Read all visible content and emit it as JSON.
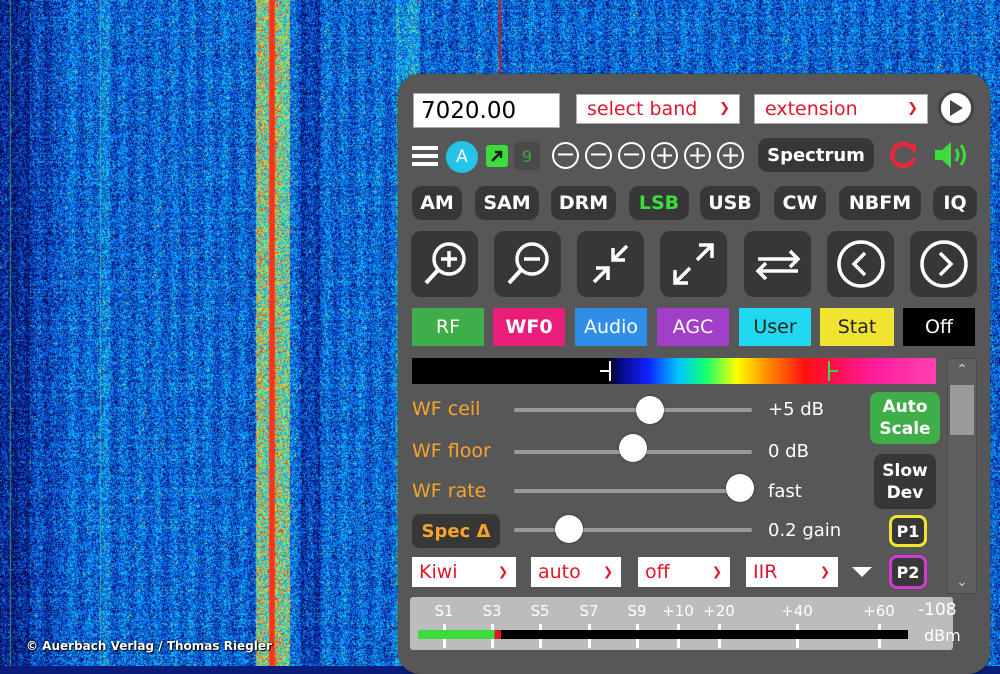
{
  "credit": "© Auerbach Verlag / Thomas Riegler",
  "frequency": {
    "value": "7020.00"
  },
  "band_select": {
    "label": "select band"
  },
  "extension_select": {
    "label": "extension"
  },
  "toolbar": {
    "badge_a": "A",
    "count_9": "9",
    "zoom_buttons": [
      "−",
      "−",
      "−",
      "+",
      "+",
      "+"
    ],
    "spectrum_label": "Spectrum"
  },
  "modes": [
    "AM",
    "SAM",
    "DRM",
    "LSB",
    "USB",
    "CW",
    "NBFM",
    "IQ"
  ],
  "active_mode": "LSB",
  "tabs": {
    "rf": "RF",
    "wf0": "WF0",
    "audio": "Audio",
    "agc": "AGC",
    "user": "User",
    "stat": "Stat",
    "off": "Off"
  },
  "waterfall": {
    "ceil": {
      "label": "WF ceil",
      "value": "+5 dB",
      "level": 0.57
    },
    "floor": {
      "label": "WF floor",
      "value": "0 dB",
      "level": 0.5
    },
    "rate": {
      "label": "WF rate",
      "value": "fast",
      "level": 0.95
    },
    "spec": {
      "label": "Spec Δ",
      "value": "0.2 gain",
      "level": 0.23
    }
  },
  "buttons": {
    "auto_scale": [
      "Auto",
      "Scale"
    ],
    "slow_dev": [
      "Slow",
      "Dev"
    ],
    "p1": "P1",
    "p2": "P2"
  },
  "dropdowns": [
    "Kiwi",
    "auto",
    "off",
    "IIR"
  ],
  "smeter": {
    "ticks": [
      "S1",
      "S3",
      "S5",
      "S7",
      "S9",
      "+10",
      "+20",
      "+40",
      "+60"
    ],
    "reading": "-108",
    "unit": "dBm",
    "level_fraction": 0.17
  },
  "colors": {
    "panel": "#575757",
    "button_dark": "#373737",
    "accent_orange": "#f7a52a",
    "select_red": "#e0162b",
    "lsb_green": "#3cdc3c",
    "rf_tab": "#3fad48",
    "wf0_tab": "#e91e7a",
    "audio_tab": "#2f8fe8",
    "agc_tab": "#a23fc8",
    "user_tab": "#20d8f0",
    "stat_tab": "#f0e430",
    "off_tab": "#000000"
  }
}
